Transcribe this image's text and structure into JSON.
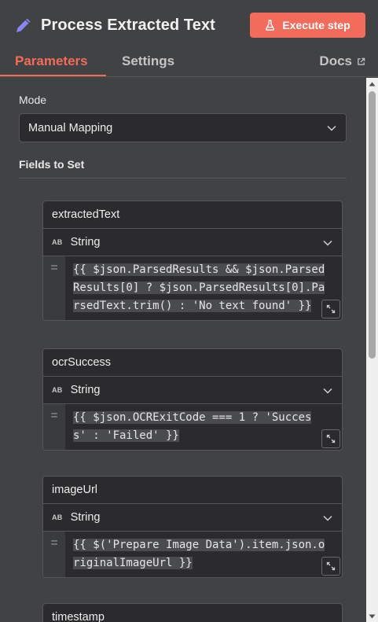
{
  "header": {
    "title": "Process Extracted Text",
    "execute_label": "Execute step"
  },
  "tabs": [
    {
      "label": "Parameters",
      "active": true
    },
    {
      "label": "Settings",
      "active": false
    }
  ],
  "docs_label": "Docs",
  "mode": {
    "label": "Mode",
    "value": "Manual Mapping"
  },
  "fields_label": "Fields to Set",
  "fields": [
    {
      "name": "extractedText",
      "type": "String",
      "type_icon": "AB",
      "expression_lines": [
        "{{ $json.ParsedResults && $json.Parsed",
        "Results[0] ? $json.ParsedResults[0].Pa",
        "rsedText.trim() : 'No text found' }}"
      ]
    },
    {
      "name": "ocrSuccess",
      "type": "String",
      "type_icon": "AB",
      "expression_lines": [
        "{{ $json.OCRExitCode === 1 ? 'Succes",
        "s' : 'Failed' }}"
      ]
    },
    {
      "name": "imageUrl",
      "type": "String",
      "type_icon": "AB",
      "expression_lines": [
        "{{ $('Prepare Image Data').item.json.o",
        "riginalImageUrl }}"
      ]
    },
    {
      "name": "timestamp"
    }
  ],
  "colors": {
    "accent": "#f26b5b",
    "pencil": "#8b84f4",
    "panel_bg": "#414244",
    "input_bg": "#2b2b2d"
  }
}
